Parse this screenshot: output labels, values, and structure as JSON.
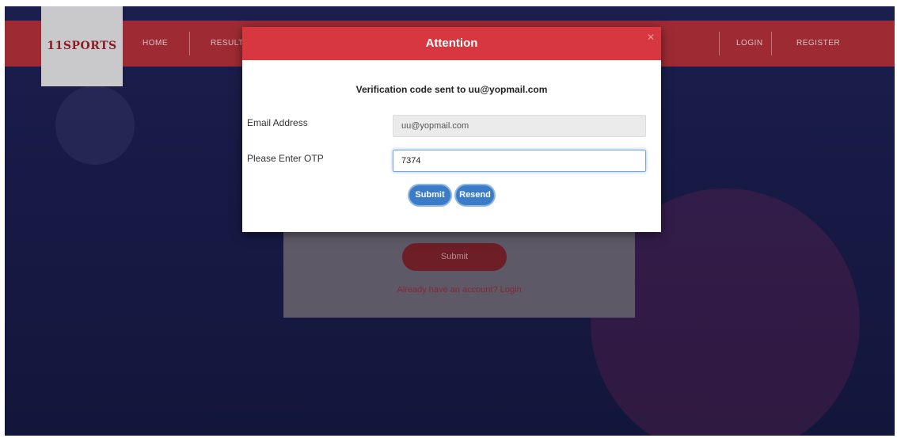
{
  "brand": {
    "logo": "11SPORTS"
  },
  "nav": {
    "left": [
      "HOME",
      "RESULT"
    ],
    "right": [
      "LOGIN",
      "REGISTER"
    ]
  },
  "background_form": {
    "submit_label": "Submit",
    "login_prompt": "Already have an account? Login"
  },
  "modal": {
    "title": "Attention",
    "message": "Verification code sent to uu@yopmail.com",
    "email_label": "Email Address",
    "email_value": "uu@yopmail.com",
    "otp_label": "Please Enter OTP",
    "otp_value": "7374",
    "submit_label": "Submit",
    "resend_label": "Resend"
  },
  "colors": {
    "header_red": "#d7373f",
    "nav_red": "#9e2b33",
    "background_navy": "#1c1f4e",
    "button_blue": "#3a7cc8"
  }
}
